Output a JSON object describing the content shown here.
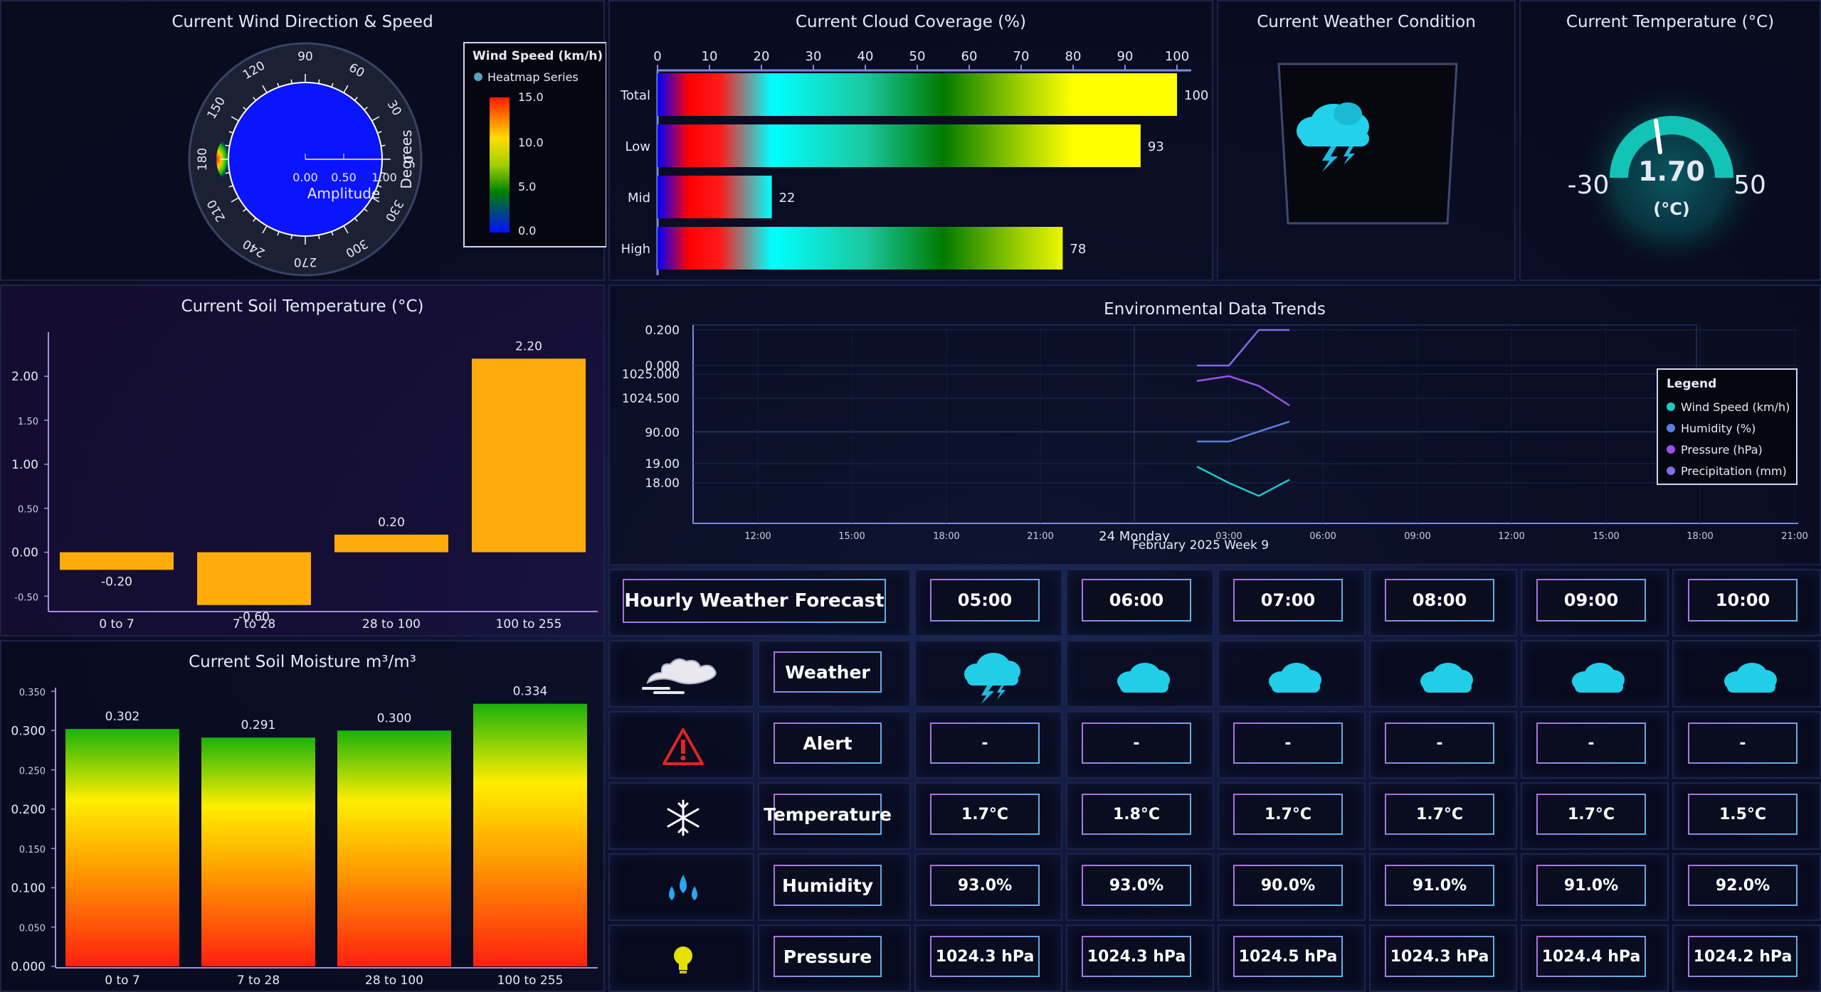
{
  "wind": {
    "title": "Current Wind Direction & Speed",
    "angles": [
      "90",
      "60",
      "30",
      "0",
      "330",
      "300",
      "270",
      "240",
      "210",
      "180",
      "150",
      "120"
    ],
    "radial_ticks": [
      "0.00",
      "0.50",
      "1.00"
    ],
    "amplitude_label": "Amplitude",
    "degrees_label": "Degrees",
    "legend_title": "Wind Speed (km/h)",
    "legend_series": "Heatmap Series",
    "scale": [
      "15.0",
      "10.0",
      "5.0",
      "0.0"
    ]
  },
  "cloud": {
    "title": "Current Cloud Coverage (%)",
    "chart_data": {
      "type": "bar",
      "categories": [
        "Total",
        "Low",
        "Mid",
        "High"
      ],
      "values": [
        100,
        93,
        22,
        78
      ],
      "xlim": [
        0,
        100
      ],
      "ticks": [
        "0",
        "10",
        "20",
        "30",
        "40",
        "50",
        "60",
        "70",
        "80",
        "90",
        "100"
      ]
    }
  },
  "condition": {
    "title": "Current Weather Condition",
    "icon": "thunderstorm-icon"
  },
  "temperature": {
    "title": "Current Temperature (°C)",
    "value": "1.70",
    "unit": "(°C)",
    "min": "-30",
    "max": "50",
    "accent": "#13c3b5"
  },
  "soil_temp": {
    "title": "Current Soil Temperature (°C)",
    "chart_data": {
      "type": "bar",
      "categories": [
        "0 to 7",
        "7 to 28",
        "28 to 100",
        "100 to 255"
      ],
      "values": [
        -0.2,
        -0.6,
        0.2,
        2.2
      ],
      "labels": [
        "-0.20",
        "-0.60",
        "0.20",
        "2.20"
      ],
      "ylim": [
        -0.6,
        2.2
      ],
      "yticks": [
        "2.00",
        "1.50",
        "1.00",
        "0.50",
        "0.00",
        "-0.50"
      ],
      "color": "#ffac0a"
    }
  },
  "soil_moist": {
    "title": "Current Soil Moisture m³/m³",
    "chart_data": {
      "type": "bar",
      "categories": [
        "0 to 7",
        "7 to 28",
        "28 to 100",
        "100 to 255"
      ],
      "values": [
        0.302,
        0.291,
        0.3,
        0.334
      ],
      "labels": [
        "0.302",
        "0.291",
        "0.300",
        "0.334"
      ],
      "ylim": [
        0,
        0.35
      ],
      "yticks": [
        "0.350",
        "0.300",
        "0.250",
        "0.200",
        "0.150",
        "0.100",
        "0.050",
        "0.000"
      ]
    }
  },
  "trends": {
    "title": "Environmental Data Trends",
    "y_ticks": [
      "0.200",
      "0.000",
      "1025.000",
      "1024.500",
      "90.00",
      "19.00",
      "18.00"
    ],
    "x_ticks": [
      "12:00",
      "15:00",
      "18:00",
      "21:00",
      "24 Monday",
      "03:00",
      "06:00",
      "09:00",
      "12:00",
      "15:00",
      "18:00",
      "21:00"
    ],
    "x_caption": "February 2025 Week 9",
    "legend_title": "Legend",
    "chart_data": {
      "type": "line",
      "series": [
        {
          "name": "Wind Speed (km/h)",
          "color": "#1ec8c8",
          "values": [
            18.9,
            18.4,
            18.0,
            18.5
          ]
        },
        {
          "name": "Humidity (%)",
          "color": "#5b7fe0",
          "values": [
            91,
            91,
            92,
            93
          ]
        },
        {
          "name": "Pressure (hPa)",
          "color": "#9a52e6",
          "values": [
            1024.8,
            1024.9,
            1024.7,
            1024.3
          ]
        },
        {
          "name": "Precipitation (mm)",
          "color": "#7d6ee8",
          "values": [
            0.0,
            0.0,
            0.2,
            0.2
          ]
        }
      ]
    }
  },
  "forecast": {
    "header": "Hourly Weather Forecast",
    "hours": [
      "05:00",
      "06:00",
      "07:00",
      "08:00",
      "09:00",
      "10:00"
    ],
    "rows": [
      {
        "label": "Weather",
        "icon": "wind-cloud-icon",
        "values": [
          "storm",
          "cloud",
          "cloud",
          "cloud",
          "cloud",
          "cloud"
        ]
      },
      {
        "label": "Alert",
        "icon": "alert-triangle-icon",
        "values": [
          "-",
          "-",
          "-",
          "-",
          "-",
          "-"
        ]
      },
      {
        "label": "Temperature",
        "icon": "snowflake-icon",
        "values": [
          "1.7°C",
          "1.8°C",
          "1.7°C",
          "1.7°C",
          "1.7°C",
          "1.5°C"
        ]
      },
      {
        "label": "Humidity",
        "icon": "water-drops-icon",
        "values": [
          "93.0%",
          "93.0%",
          "90.0%",
          "91.0%",
          "91.0%",
          "92.0%"
        ]
      },
      {
        "label": "Pressure",
        "icon": "lightbulb-icon",
        "values": [
          "1024.3 hPa",
          "1024.3 hPa",
          "1024.5 hPa",
          "1024.3 hPa",
          "1024.4 hPa",
          "1024.2 hPa"
        ]
      }
    ]
  }
}
